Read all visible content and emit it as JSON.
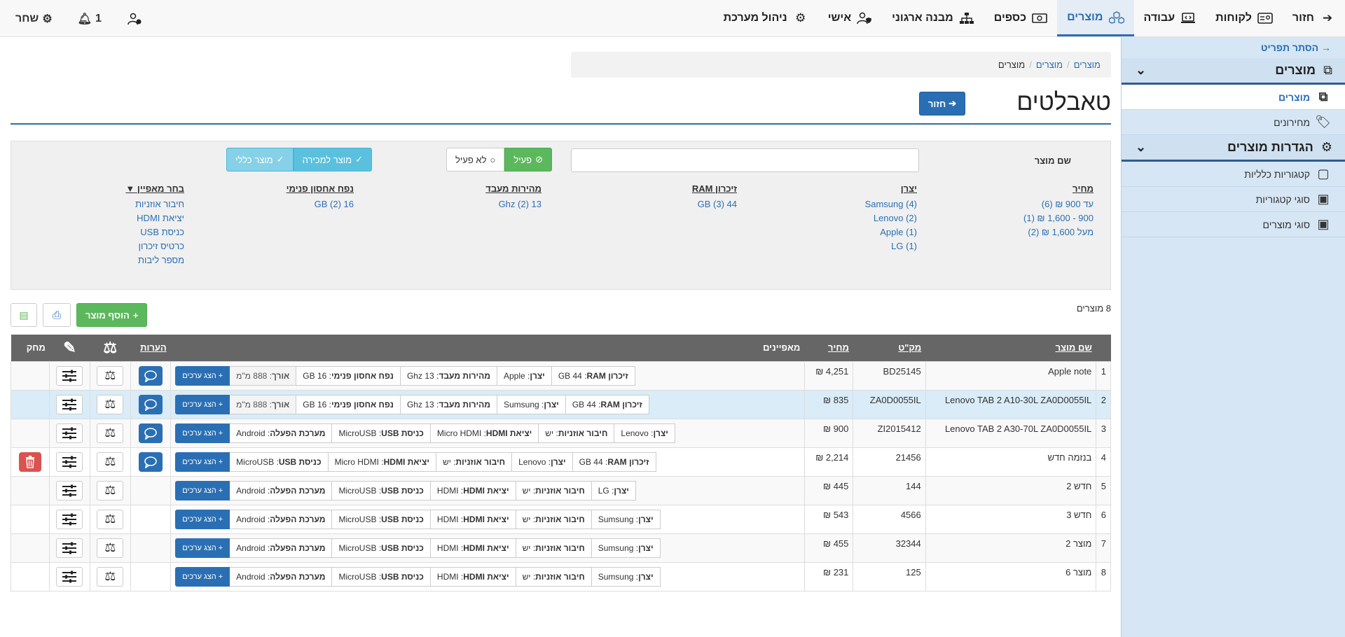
{
  "topnav": {
    "items": [
      {
        "label": "חזור",
        "icon": "arrow-right-icon"
      },
      {
        "label": "לקוחות",
        "icon": "id-card-icon"
      },
      {
        "label": "עבודה",
        "icon": "laptop-code-icon"
      },
      {
        "label": "מוצרים",
        "icon": "cubes-icon",
        "active": true
      },
      {
        "label": "כספים",
        "icon": "money-bill-icon"
      },
      {
        "label": "מבנה ארגוני",
        "icon": "sitemap-icon"
      },
      {
        "label": "אישי",
        "icon": "user-shield-icon"
      },
      {
        "label": "ניהול מערכת",
        "icon": "cogs-icon"
      }
    ],
    "notifications_count": "1",
    "release_label": "שחר"
  },
  "sidebar": {
    "hide_label": "הסתר תפריט",
    "sections": [
      {
        "title": "מוצרים",
        "items": [
          {
            "label": "מוצרים",
            "active": true
          },
          {
            "label": "מחירונים"
          }
        ]
      },
      {
        "title": "הגדרות מוצרים",
        "items": [
          {
            "label": "קטגוריות כלליות"
          },
          {
            "label": "סוגי קטגוריות"
          },
          {
            "label": "סוגי מוצרים"
          }
        ]
      }
    ]
  },
  "breadcrumb": [
    "מוצרים",
    "מוצרים",
    "מוצרים"
  ],
  "page": {
    "title": "טאבלטים",
    "back_label": "חזור"
  },
  "filter": {
    "name_label": "שם מוצר",
    "name_value": "",
    "status_active": "פעיל",
    "status_inactive": "לא פעיל",
    "type_sale": "מוצר למכירה",
    "type_general": "מוצר כללי",
    "price": {
      "title": "מחיר",
      "values": [
        "עד 900 ₪ (6)",
        "900 - 1,600 ₪ (1)",
        "מעל 1,600 ₪ (2)"
      ]
    },
    "maker": {
      "title": "יצרן",
      "values": [
        "Samsung (4)",
        "Lenovo (2)",
        "Apple (1)",
        "LG (1)"
      ]
    },
    "ram": {
      "title": "זיכרון RAM",
      "values": [
        "44 GB (3)"
      ]
    },
    "cpu": {
      "title": "מהירות מעבד",
      "values": [
        "13 Ghz (2)"
      ]
    },
    "storage": {
      "title": "נפח אחסון פנימי",
      "values": [
        "16 GB (2)"
      ]
    },
    "features": {
      "title": "בחר מאפיין",
      "values": [
        "חיבור אוזניות",
        "יציאת HDMI",
        "כניסת USB",
        "כרטיס זיכרון",
        "מספר ליבות"
      ]
    }
  },
  "count_label": "8 מוצרים",
  "add_label": "הוסף מוצר",
  "table": {
    "headers": {
      "name": "שם מוצר",
      "sku": "מק\"ט",
      "price": "מחיר",
      "attrs": "מאפיינים",
      "notes": "הערות",
      "delete": "מחק"
    },
    "show_values_label": "הצג ערכים",
    "rows": [
      {
        "num": "1",
        "name": "Apple note",
        "sku": "BD25145",
        "price": "4,251 ₪",
        "notes": true,
        "del": false,
        "attrs": [
          {
            "k": "זיכרון RAM",
            "v": "44 GB"
          },
          {
            "k": "יצרן",
            "v": "Apple"
          },
          {
            "k": "מהירות מעבד",
            "v": "13 Ghz"
          },
          {
            "k": "נפח אחסון פנימי",
            "v": "16 GB"
          },
          {
            "k": "אורך",
            "v": "888 מ\"מ",
            "ext": true
          }
        ]
      },
      {
        "num": "2",
        "name": "Lenovo TAB 2 A10-30L ZA0D0055IL",
        "sku": "ZA0D0055IL",
        "price": "835 ₪",
        "notes": true,
        "del": false,
        "attrs": [
          {
            "k": "זיכרון RAM",
            "v": "44 GB"
          },
          {
            "k": "יצרן",
            "v": "Sumsung"
          },
          {
            "k": "מהירות מעבד",
            "v": "13 Ghz"
          },
          {
            "k": "נפח אחסון פנימי",
            "v": "16 GB"
          },
          {
            "k": "אורך",
            "v": "888 מ\"מ",
            "ext": true
          }
        ]
      },
      {
        "num": "3",
        "name": "Lenovo TAB 2 A30-70L ZA0D0055IL",
        "sku": "ZI2015412",
        "price": "900 ₪",
        "notes": true,
        "del": false,
        "attrs": [
          {
            "k": "יצרן",
            "v": "Lenovo"
          },
          {
            "k": "חיבור אוזניות",
            "v": "יש"
          },
          {
            "k": "יציאת HDMI",
            "v": "Micro HDMI"
          },
          {
            "k": "כניסת USB",
            "v": "MicroUSB"
          },
          {
            "k": "מערכת הפעלה",
            "v": "Android"
          }
        ]
      },
      {
        "num": "4",
        "name": "בנזמה חדש",
        "sku": "21456",
        "price": "2,214 ₪",
        "notes": true,
        "del": true,
        "attrs": [
          {
            "k": "זיכרון RAM",
            "v": "44 GB"
          },
          {
            "k": "יצרן",
            "v": "Lenovo"
          },
          {
            "k": "חיבור אוזניות",
            "v": "יש"
          },
          {
            "k": "יציאת HDMI",
            "v": "Micro HDMI"
          },
          {
            "k": "כניסת USB",
            "v": "MicroUSB"
          }
        ]
      },
      {
        "num": "5",
        "name": "חדש 2",
        "sku": "144",
        "price": "445 ₪",
        "notes": false,
        "del": false,
        "attrs": [
          {
            "k": "יצרן",
            "v": "LG"
          },
          {
            "k": "חיבור אוזניות",
            "v": "יש"
          },
          {
            "k": "יציאת HDMI",
            "v": "HDMI"
          },
          {
            "k": "כניסת USB",
            "v": "MicroUSB"
          },
          {
            "k": "מערכת הפעלה",
            "v": "Android"
          }
        ]
      },
      {
        "num": "6",
        "name": "חדש 3",
        "sku": "4566",
        "price": "543 ₪",
        "notes": false,
        "del": false,
        "attrs": [
          {
            "k": "יצרן",
            "v": "Sumsung"
          },
          {
            "k": "חיבור אוזניות",
            "v": "יש"
          },
          {
            "k": "יציאת HDMI",
            "v": "HDMI"
          },
          {
            "k": "כניסת USB",
            "v": "MicroUSB"
          },
          {
            "k": "מערכת הפעלה",
            "v": "Android"
          }
        ]
      },
      {
        "num": "7",
        "name": "מוצר 2",
        "sku": "32344",
        "price": "455 ₪",
        "notes": false,
        "del": false,
        "attrs": [
          {
            "k": "יצרן",
            "v": "Sumsung"
          },
          {
            "k": "חיבור אוזניות",
            "v": "יש"
          },
          {
            "k": "יציאת HDMI",
            "v": "HDMI"
          },
          {
            "k": "כניסת USB",
            "v": "MicroUSB"
          },
          {
            "k": "מערכת הפעלה",
            "v": "Android"
          }
        ]
      },
      {
        "num": "8",
        "name": "מוצר 6",
        "sku": "125",
        "price": "231 ₪",
        "notes": false,
        "del": false,
        "attrs": [
          {
            "k": "יצרן",
            "v": "Sumsung"
          },
          {
            "k": "חיבור אוזניות",
            "v": "יש"
          },
          {
            "k": "יציאת HDMI",
            "v": "HDMI"
          },
          {
            "k": "כניסת USB",
            "v": "MicroUSB"
          },
          {
            "k": "מערכת הפעלה",
            "v": "Android"
          }
        ]
      }
    ]
  }
}
